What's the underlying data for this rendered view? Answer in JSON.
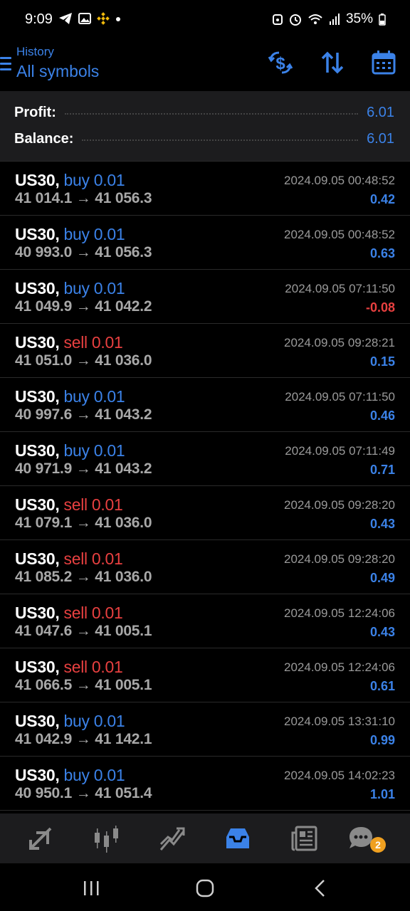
{
  "status_bar": {
    "time": "9:09",
    "battery": "35%",
    "icons_left": [
      "telegram-icon",
      "image-icon",
      "binance-icon",
      "dot-icon"
    ],
    "icons_right": [
      "alarm-icon",
      "clock-icon",
      "wifi-icon",
      "signal-icon",
      "battery-icon"
    ]
  },
  "header": {
    "title": "History",
    "subtitle": "All symbols",
    "actions": [
      "currency-exchange-icon",
      "sort-icon",
      "calendar-icon"
    ]
  },
  "summary": {
    "profit_label": "Profit:",
    "profit_value": "6.01",
    "balance_label": "Balance:",
    "balance_value": "6.01"
  },
  "trades": [
    {
      "symbol": "US30,",
      "side": "buy 0.01",
      "open": "41 014.1",
      "arrow": "→",
      "close": "41 056.3",
      "time": "2024.09.05 00:48:52",
      "profit": "0.42"
    },
    {
      "symbol": "US30,",
      "side": "buy 0.01",
      "open": "40 993.0",
      "arrow": "→",
      "close": "41 056.3",
      "time": "2024.09.05 00:48:52",
      "profit": "0.63"
    },
    {
      "symbol": "US30,",
      "side": "buy 0.01",
      "open": "41 049.9",
      "arrow": "→",
      "close": "41 042.2",
      "time": "2024.09.05 07:11:50",
      "profit": "-0.08"
    },
    {
      "symbol": "US30,",
      "side": "sell 0.01",
      "open": "41 051.0",
      "arrow": "→",
      "close": "41 036.0",
      "time": "2024.09.05 09:28:21",
      "profit": "0.15"
    },
    {
      "symbol": "US30,",
      "side": "buy 0.01",
      "open": "40 997.6",
      "arrow": "→",
      "close": "41 043.2",
      "time": "2024.09.05 07:11:50",
      "profit": "0.46"
    },
    {
      "symbol": "US30,",
      "side": "buy 0.01",
      "open": "40 971.9",
      "arrow": "→",
      "close": "41 043.2",
      "time": "2024.09.05 07:11:49",
      "profit": "0.71"
    },
    {
      "symbol": "US30,",
      "side": "sell 0.01",
      "open": "41 079.1",
      "arrow": "→",
      "close": "41 036.0",
      "time": "2024.09.05 09:28:20",
      "profit": "0.43"
    },
    {
      "symbol": "US30,",
      "side": "sell 0.01",
      "open": "41 085.2",
      "arrow": "→",
      "close": "41 036.0",
      "time": "2024.09.05 09:28:20",
      "profit": "0.49"
    },
    {
      "symbol": "US30,",
      "side": "sell 0.01",
      "open": "41 047.6",
      "arrow": "→",
      "close": "41 005.1",
      "time": "2024.09.05 12:24:06",
      "profit": "0.43"
    },
    {
      "symbol": "US30,",
      "side": "sell 0.01",
      "open": "41 066.5",
      "arrow": "→",
      "close": "41 005.1",
      "time": "2024.09.05 12:24:06",
      "profit": "0.61"
    },
    {
      "symbol": "US30,",
      "side": "buy 0.01",
      "open": "41 042.9",
      "arrow": "→",
      "close": "41 142.1",
      "time": "2024.09.05 13:31:10",
      "profit": "0.99"
    },
    {
      "symbol": "US30,",
      "side": "buy 0.01",
      "open": "40 950.1",
      "arrow": "→",
      "close": "41 051.4",
      "time": "2024.09.05 14:02:23",
      "profit": "1.01"
    }
  ],
  "tab_bar": {
    "tabs": [
      "quotes-icon",
      "chart-icon",
      "trade-icon",
      "history-icon",
      "news-icon",
      "messages-icon"
    ],
    "active": "history-icon",
    "messages_badge": "2"
  },
  "colors": {
    "accent": "#3b82e8",
    "loss": "#e84040",
    "badge": "#f0a020"
  }
}
